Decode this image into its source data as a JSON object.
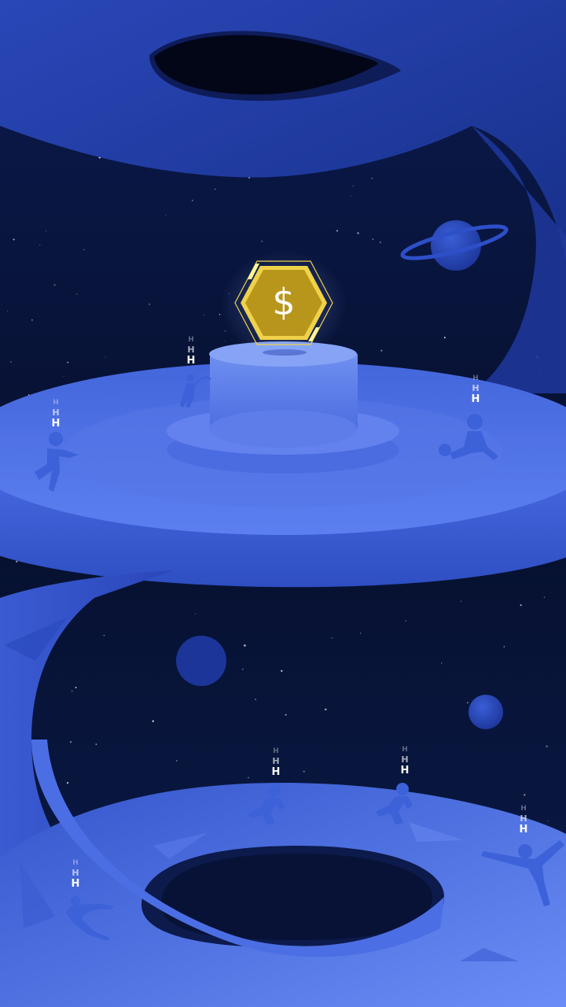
{
  "colors": {
    "space_deep": "#050c2a",
    "space_mid": "#0d1e56",
    "platform_top": "#4d6fe0",
    "platform_light": "#7e9ef5",
    "platform_side": "#3050c4",
    "coin_gold": "#b8961c",
    "coin_border": "#f0d24a",
    "figure": "#3a5fd6"
  },
  "coin": {
    "symbol": "$",
    "icon": "dollar-hexagon-icon"
  },
  "activity_markers": [
    {
      "label": "H",
      "icon": "batter-figure-icon"
    },
    {
      "label": "H",
      "icon": "runner-figure-icon"
    },
    {
      "label": "H",
      "icon": "rower-figure-icon"
    },
    {
      "label": "H",
      "icon": "sprinter-figure-icon"
    },
    {
      "label": "H",
      "icon": "sprinter-figure-icon"
    },
    {
      "label": "H",
      "icon": "dancer-figure-icon"
    },
    {
      "label": "H",
      "icon": "swimmer-figure-icon"
    }
  ]
}
